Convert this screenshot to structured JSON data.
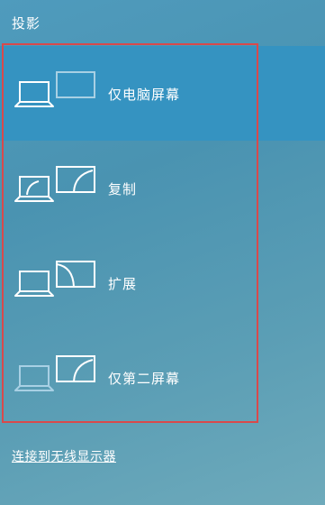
{
  "panel": {
    "title": "投影"
  },
  "options": [
    {
      "label": "仅电脑屏幕",
      "icon": "pc-screen-only-icon",
      "selected": true
    },
    {
      "label": "复制",
      "icon": "duplicate-icon",
      "selected": false
    },
    {
      "label": "扩展",
      "icon": "extend-icon",
      "selected": false
    },
    {
      "label": "仅第二屏幕",
      "icon": "second-screen-only-icon",
      "selected": false
    }
  ],
  "footer": {
    "wireless_link": "连接到无线显示器"
  },
  "colors": {
    "selected_bg": "#3593c1",
    "highlight_frame": "#d9494b",
    "dim_icon": "#a8d0e4"
  }
}
